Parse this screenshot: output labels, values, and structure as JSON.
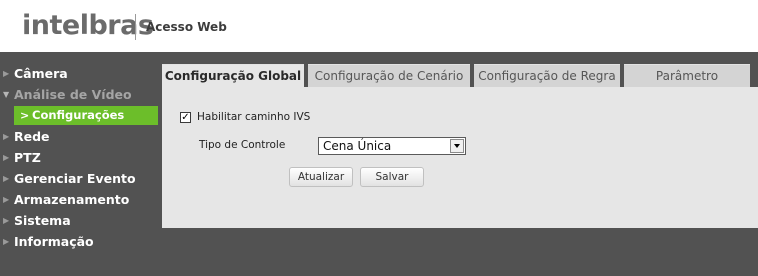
{
  "header": {
    "logo": "intelbras",
    "title": "Acesso Web"
  },
  "sidebar": {
    "items": [
      {
        "label": "Câmera",
        "state": "collapsed"
      },
      {
        "label": "Análise de Vídeo",
        "state": "expanded"
      },
      {
        "label": "Configurações",
        "state": "active"
      },
      {
        "label": "Rede",
        "state": "collapsed"
      },
      {
        "label": "PTZ",
        "state": "collapsed"
      },
      {
        "label": "Gerenciar Evento",
        "state": "collapsed"
      },
      {
        "label": "Armazenamento",
        "state": "collapsed"
      },
      {
        "label": "Sistema",
        "state": "collapsed"
      },
      {
        "label": "Informação",
        "state": "collapsed"
      }
    ]
  },
  "tabs": [
    {
      "label": "Configuração Global",
      "active": true
    },
    {
      "label": "Configuração de Cenário",
      "active": false
    },
    {
      "label": "Configuração de Regra",
      "active": false
    },
    {
      "label": "Parâmetro",
      "active": false
    }
  ],
  "form": {
    "ivs_checkbox_label": "Habilitar caminho IVS",
    "ivs_checked": true,
    "control_type_label": "Tipo de Controle",
    "control_type_value": "Cena Única",
    "refresh_button": "Atualizar",
    "save_button": "Salvar"
  },
  "colors": {
    "accent": "#6cbe2a",
    "background_dark": "#525252",
    "panel": "#e6e6e6"
  },
  "icons": {
    "nav_arrow": "triangle-right-icon",
    "nav_expanded_arrow": "triangle-down-icon",
    "active_arrow": "chevron-right-icon",
    "dropdown": "triangle-down-icon",
    "checkbox": "checkmark-icon"
  }
}
